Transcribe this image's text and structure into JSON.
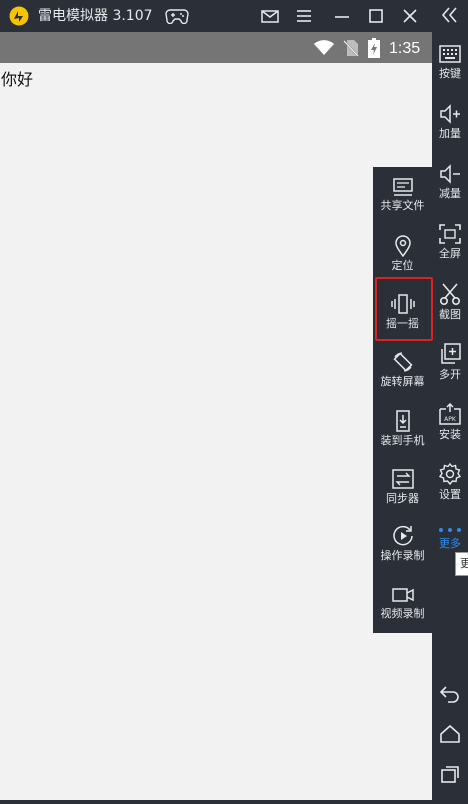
{
  "titlebar": {
    "app_title": "雷电模拟器 3.107",
    "icons": [
      "logo-icon",
      "gamepad-icon",
      "mail-icon",
      "menu-icon",
      "minimize-icon",
      "maximize-icon",
      "close-icon"
    ]
  },
  "statusbar": {
    "time": "1:35",
    "icons": [
      "wifi-icon",
      "no-sim-icon",
      "battery-charging-icon"
    ]
  },
  "screen": {
    "text": "你好"
  },
  "sidebar": {
    "collapse_icon": "double-chevron-left-icon",
    "items": [
      {
        "label": "按键",
        "icon": "keyboard-icon"
      },
      {
        "label": "加量",
        "icon": "volume-up-icon"
      },
      {
        "label": "减量",
        "icon": "volume-down-icon"
      },
      {
        "label": "全屏",
        "icon": "fullscreen-icon"
      },
      {
        "label": "截图",
        "icon": "scissors-icon"
      },
      {
        "label": "多开",
        "icon": "multi-open-icon"
      },
      {
        "label": "安装",
        "icon": "apk-install-icon"
      },
      {
        "label": "设置",
        "icon": "gear-icon"
      },
      {
        "label": "更多",
        "icon": "more-dots-icon"
      }
    ],
    "tooltip": "更",
    "nav": [
      "back-icon",
      "home-icon",
      "recents-icon"
    ]
  },
  "panel": {
    "items": [
      {
        "label": "共享文件",
        "icon": "share-file-icon"
      },
      {
        "label": "定位",
        "icon": "location-pin-icon"
      },
      {
        "label": "摇一摇",
        "icon": "shake-icon"
      },
      {
        "label": "旋转屏幕",
        "icon": "rotate-screen-icon"
      },
      {
        "label": "装到手机",
        "icon": "install-to-phone-icon"
      },
      {
        "label": "同步器",
        "icon": "sync-icon"
      },
      {
        "label": "操作录制",
        "icon": "operation-record-icon"
      },
      {
        "label": "视频录制",
        "icon": "video-record-icon"
      }
    ]
  },
  "colors": {
    "chrome": "#2b2f37",
    "statusbar": "#757575",
    "screen": "#f2f2f2",
    "accent": "#2d8cf0",
    "highlight": "#e02020"
  }
}
